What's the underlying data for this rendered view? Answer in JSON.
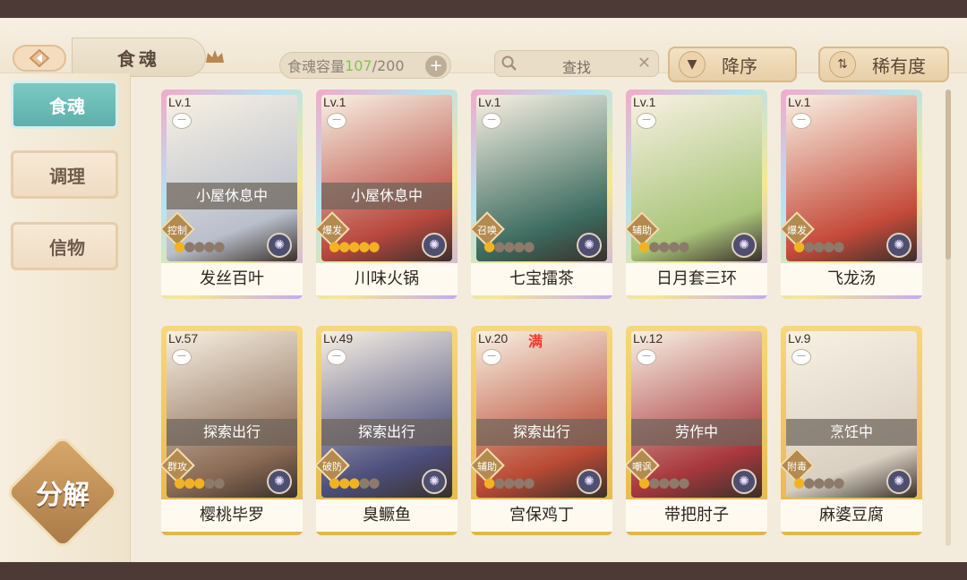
{
  "header": {
    "title": "食魂",
    "capacity_label": "食魂容量",
    "capacity_used": "107",
    "capacity_total": "/200",
    "plus": "+",
    "search_label": "查找",
    "search_clear": "✕",
    "sort_desc": "降序",
    "sort_rarity": "稀有度"
  },
  "sidebar": {
    "tabs": [
      {
        "label": "食魂"
      },
      {
        "label": "调理"
      },
      {
        "label": "信物"
      }
    ],
    "decompose": "分解"
  },
  "cards": [
    {
      "level": "Lv.1",
      "status": "小屋休息中",
      "role": "控制",
      "stars_on": 1,
      "stars_off": 4,
      "name": "发丝百叶",
      "frame": "rainbow",
      "art": "#b9bfcb"
    },
    {
      "level": "Lv.1",
      "status": "小屋休息中",
      "role": "爆发",
      "stars_on": 5,
      "stars_off": 0,
      "name": "川味火锅",
      "frame": "rainbow",
      "art": "#b8483e"
    },
    {
      "level": "Lv.1",
      "status": "",
      "role": "召唤",
      "stars_on": 1,
      "stars_off": 4,
      "name": "七宝擂茶",
      "frame": "rainbow",
      "art": "#3d6b5f"
    },
    {
      "level": "Lv.1",
      "status": "",
      "role": "辅助",
      "stars_on": 1,
      "stars_off": 4,
      "name": "日月套三环",
      "frame": "rainbow",
      "art": "#a9c479"
    },
    {
      "level": "Lv.1",
      "status": "",
      "role": "爆发",
      "stars_on": 1,
      "stars_off": 4,
      "name": "飞龙汤",
      "frame": "rainbow",
      "art": "#c44a3a"
    },
    {
      "level": "Lv.57",
      "status": "探索出行",
      "role": "群攻",
      "stars_on": 3,
      "stars_off": 2,
      "name": "樱桃毕罗",
      "frame": "gold",
      "art": "#8a6a55"
    },
    {
      "level": "Lv.49",
      "status": "探索出行",
      "role": "破防",
      "stars_on": 3,
      "stars_off": 2,
      "name": "臭鳜鱼",
      "frame": "gold",
      "art": "#4d4f7d"
    },
    {
      "level": "Lv.20",
      "status": "探索出行",
      "role": "辅助",
      "stars_on": 1,
      "stars_off": 4,
      "name": "宫保鸡丁",
      "frame": "gold",
      "art": "#b94a34"
    },
    {
      "level": "Lv.12",
      "status": "劳作中",
      "role": "嘲讽",
      "stars_on": 1,
      "stars_off": 4,
      "name": "带把肘子",
      "frame": "gold",
      "art": "#a8383d"
    },
    {
      "level": "Lv.9",
      "status": "烹饪中",
      "role": "附毒",
      "stars_on": 1,
      "stars_off": 4,
      "name": "麻婆豆腐",
      "frame": "gold",
      "art": "#d9d0c2"
    }
  ],
  "full_mark": "满",
  "colors": {
    "accent_teal": "#5eb0ad",
    "gold": "#e4b54c"
  }
}
